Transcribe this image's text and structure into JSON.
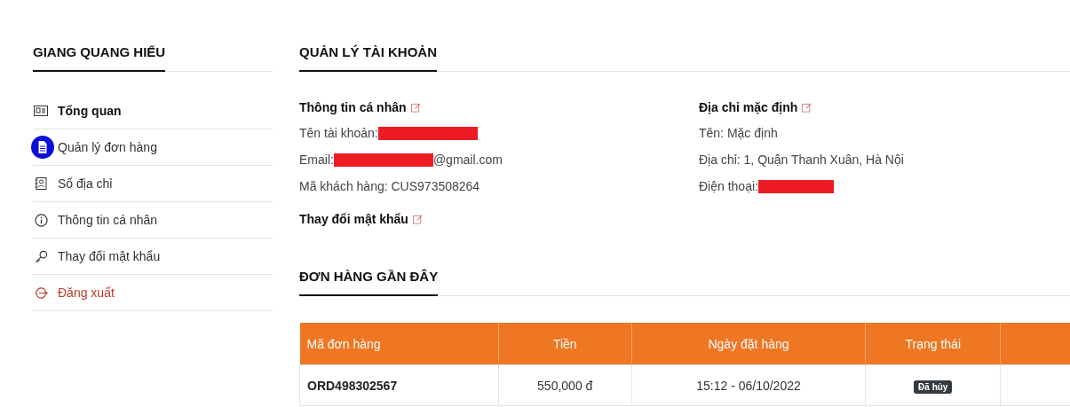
{
  "sidebar": {
    "title": "GIANG QUANG HIẾU",
    "items": [
      {
        "label": "Tổng quan",
        "selected": true
      },
      {
        "label": "Quản lý đơn hàng",
        "selected": false
      },
      {
        "label": "Sổ địa chỉ",
        "selected": false
      },
      {
        "label": "Thông tin cá nhân",
        "selected": false
      },
      {
        "label": "Thay đổi mật khẩu",
        "selected": false
      },
      {
        "label": "Đăng xuất",
        "selected": false,
        "kind": "danger"
      }
    ]
  },
  "account": {
    "title": "QUẢN LÝ TÀI KHOẢN",
    "personal": {
      "heading": "Thông tin cá nhân",
      "lines": [
        {
          "label": "Tên tài khoản:",
          "redacted": true
        },
        {
          "label": "Email:",
          "redacted": true,
          "value": "@gmail.com"
        },
        {
          "label": "Mã khách hàng: CUS973508264",
          "redacted": false
        }
      ]
    },
    "address": {
      "heading": "Địa chỉ mặc định",
      "lines": [
        {
          "label": "Tên: Mặc định",
          "redacted": false
        },
        {
          "label": "Địa chỉ: 1, Quận Thanh Xuân, Hà Nội",
          "redacted": false
        },
        {
          "label": "Điện thoại:",
          "redacted": true
        }
      ]
    },
    "password": {
      "heading": "Thay đổi mật khẩu"
    }
  },
  "orders": {
    "title": "ĐƠN HÀNG GẦN ĐÂY",
    "columns": [
      "Mã đơn hàng",
      "Tiền",
      "Ngày đặt hàng",
      "Trạng thái"
    ],
    "rows": [
      {
        "id": "ORD498302567",
        "amount": "550,000 đ",
        "date": "15:12 - 06/10/2022",
        "status": "Đã hủy"
      }
    ]
  }
}
